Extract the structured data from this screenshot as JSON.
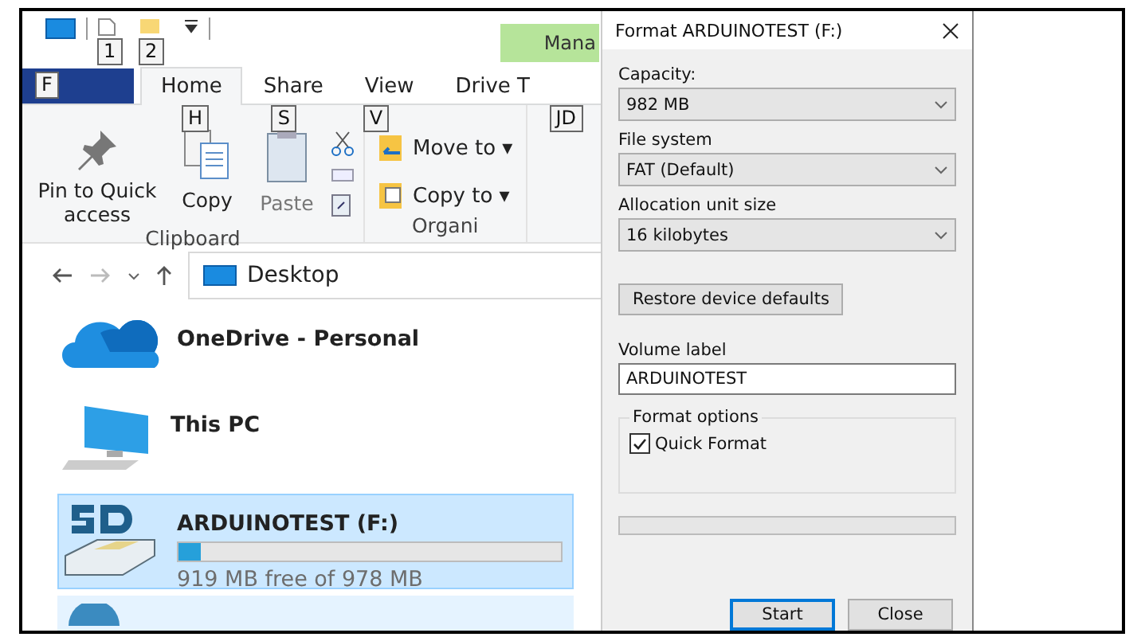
{
  "quick_access": {
    "keytips": [
      "1",
      "2"
    ]
  },
  "contextual_tab_group": "Mana",
  "tabs": [
    {
      "kind": "file",
      "keytip": "F",
      "selected": false
    },
    {
      "kind": "tab",
      "label": "Home",
      "keytip": "H",
      "selected": true
    },
    {
      "kind": "tab",
      "label": "Share",
      "keytip": "S",
      "selected": false
    },
    {
      "kind": "tab",
      "label": "View",
      "keytip": "V",
      "selected": false
    },
    {
      "kind": "tab",
      "label": "Drive T",
      "keytip": "JD",
      "selected": false
    }
  ],
  "ribbon": {
    "groups": [
      {
        "label": "Clipboard",
        "buttons": [
          {
            "kind": "pin",
            "label": "Pin to Quick access"
          },
          {
            "kind": "copy",
            "label": "Copy"
          },
          {
            "kind": "paste",
            "label": "Paste"
          }
        ]
      },
      {
        "label": "Organi",
        "buttons": [
          {
            "kind": "move",
            "label": "Move to ▾"
          },
          {
            "kind": "copyto",
            "label": "Copy to ▾"
          }
        ]
      }
    ]
  },
  "address_bar": {
    "path": "Desktop"
  },
  "items": [
    {
      "kind": "cloud",
      "name": "OneDrive - Personal",
      "selected": false
    },
    {
      "kind": "pc",
      "name": "This PC",
      "selected": false
    },
    {
      "kind": "drive",
      "name": "ARDUINOTEST (F:)",
      "level": 0.06,
      "free": "919 MB free of 978 MB",
      "selected": true
    },
    {
      "kind": "network",
      "selected": false
    }
  ],
  "dialog": {
    "title": "Format ARDUINOTEST (F:)",
    "fields": [
      {
        "label": "Capacity:",
        "value": "982 MB"
      },
      {
        "label": "File system",
        "value": "FAT (Default)"
      },
      {
        "label": "Allocation unit size",
        "value": "16 kilobytes"
      }
    ],
    "restore_button": "Restore device defaults",
    "volume_label": {
      "label": "Volume label",
      "value": "ARDUINOTEST"
    },
    "options": {
      "title": "Format options",
      "quick_format": {
        "label": "Quick Format",
        "checked": true
      }
    },
    "progress": {
      "level": 0
    },
    "buttons": [
      {
        "label": "Start",
        "default": true
      },
      {
        "label": "Close",
        "default": false
      }
    ]
  }
}
